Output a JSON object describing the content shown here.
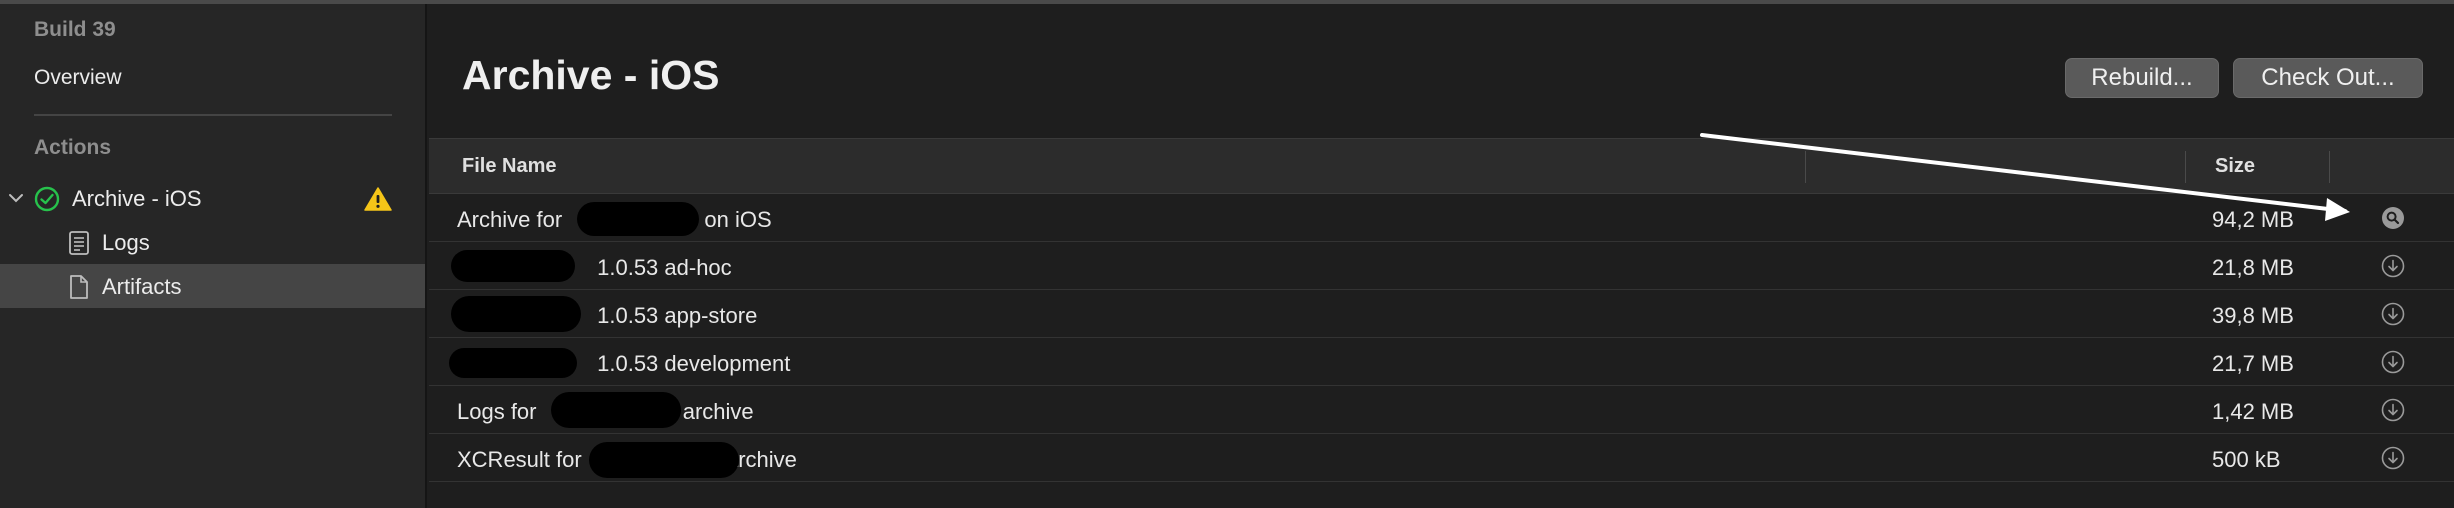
{
  "sidebar": {
    "build_title": "Build 39",
    "overview": "Overview",
    "actions_header": "Actions",
    "items": [
      {
        "label": "Archive - iOS"
      },
      {
        "label": "Logs"
      },
      {
        "label": "Artifacts"
      }
    ]
  },
  "main": {
    "title": "Archive - iOS",
    "buttons": {
      "rebuild": "Rebuild...",
      "checkout": "Check Out..."
    },
    "table": {
      "columns": [
        "File Name",
        "Size"
      ],
      "rows": [
        {
          "prefix": "Archive for",
          "suffix": "on iOS",
          "size": "94,2 MB",
          "action_icon": "search-icon"
        },
        {
          "prefix": "",
          "suffix": "1.0.53 ad-hoc",
          "size": "21,8 MB",
          "action_icon": "download-icon"
        },
        {
          "prefix": "",
          "suffix": "1.0.53 app-store",
          "size": "39,8 MB",
          "action_icon": "download-icon"
        },
        {
          "prefix": "",
          "suffix": "1.0.53 development",
          "size": "21,7 MB",
          "action_icon": "download-icon"
        },
        {
          "prefix": "Logs for",
          "suffix": "archive",
          "size": "1,42 MB",
          "action_icon": "download-icon"
        },
        {
          "prefix": "XCResult for",
          "suffix": "archive",
          "size": "500 kB",
          "action_icon": "download-icon"
        }
      ]
    }
  },
  "colors": {
    "success": "#27c24c",
    "warning": "#f5c518",
    "selected_row": "#454545"
  }
}
